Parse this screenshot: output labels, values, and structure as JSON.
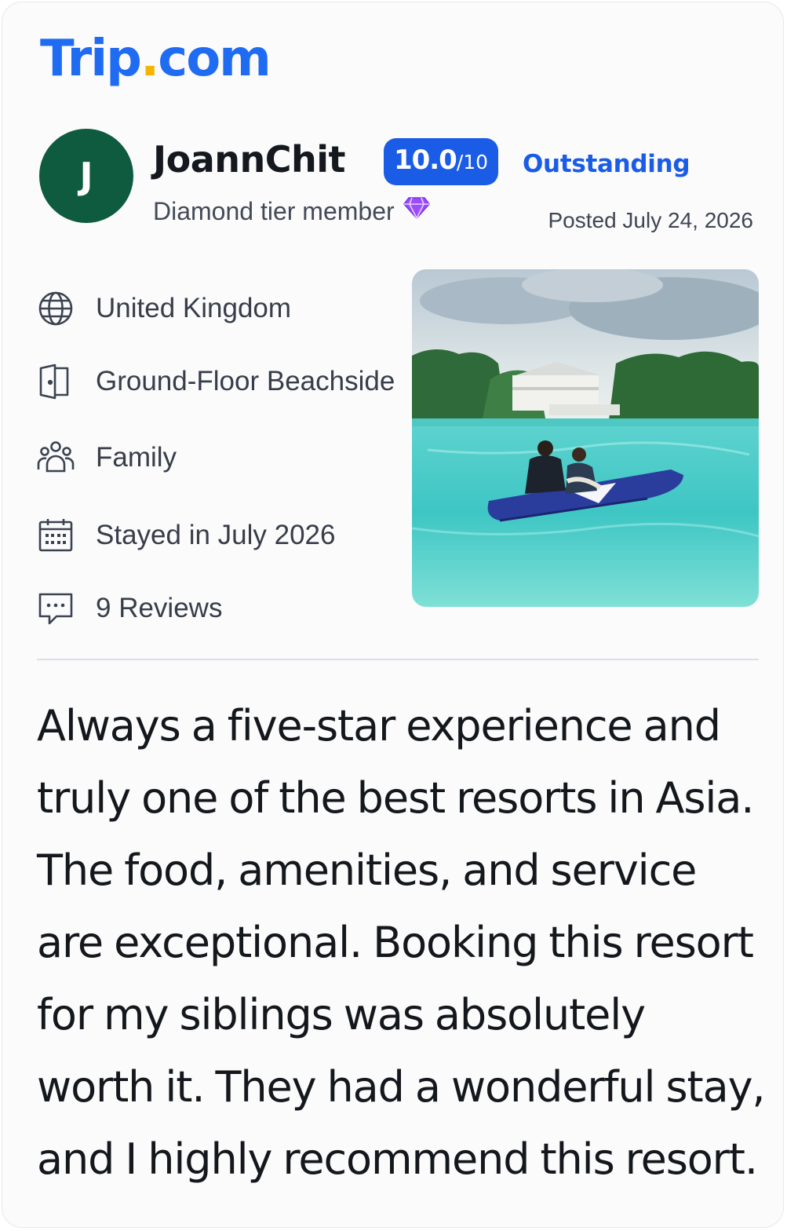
{
  "brand": {
    "logo_main": "Trip",
    "logo_dot": ".",
    "logo_suffix": "com",
    "accent": "#1f6cf3",
    "dot_color": "#f5b400"
  },
  "reviewer": {
    "initial": "J",
    "avatar_color": "#0f5b3f",
    "name": "JoannChit",
    "tier": "Diamond tier member",
    "tier_icon": "diamond-icon"
  },
  "rating": {
    "score": "10.0",
    "max": "/10",
    "label": "Outstanding",
    "badge_color": "#1a5ce6"
  },
  "posted": "Posted July 24, 2026",
  "details": [
    {
      "icon": "globe-icon",
      "text": "United Kingdom"
    },
    {
      "icon": "door-icon",
      "text": "Ground-Floor Beachside"
    },
    {
      "icon": "group-icon",
      "text": "Family"
    },
    {
      "icon": "calendar-icon",
      "text": "Stayed in July 2026"
    },
    {
      "icon": "chat-icon",
      "text": "9 Reviews"
    }
  ],
  "review_text": "Always a five-star experience and truly one of the best resorts in Asia. The food, amenities, and service are exceptional. Booking this resort for my siblings was absolutely worth it. They had a wonderful stay, and I highly recommend this resort."
}
